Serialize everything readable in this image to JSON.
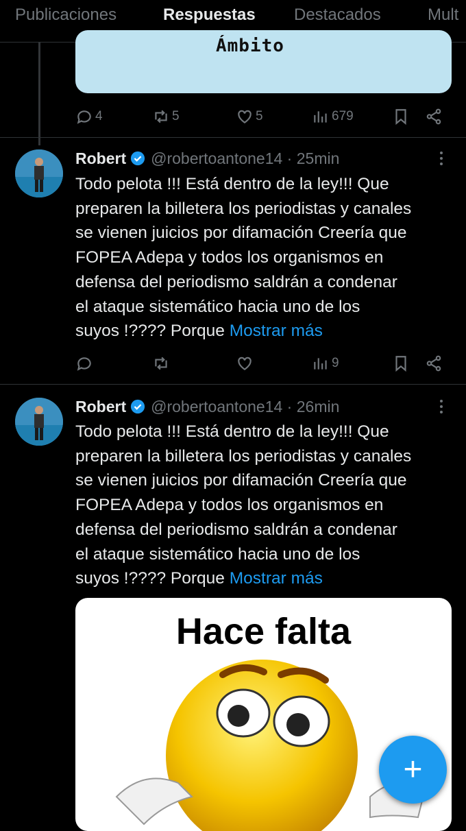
{
  "tabs": [
    "Publicaciones",
    "Respuestas",
    "Destacados",
    "Mult"
  ],
  "top_card_text": "Ámbito",
  "top_actions": {
    "replies": "4",
    "reposts": "5",
    "likes": "5",
    "views": "679"
  },
  "tweet1": {
    "name": "Robert",
    "handle": "@robertoantone14",
    "time": "25min",
    "lines": [
      "Todo pelota !!! Está dentro de la ley!!! Que",
      "preparen la billetera los periodistas y canales",
      "se vienen juicios por difamación Creería que",
      "FOPEA Adepa y todos los organismos en",
      "defensa del periodismo saldrán a condenar",
      "el ataque sistemático hacia uno de los",
      "suyos !???? Porque "
    ],
    "show_more": "Mostrar más",
    "views": "9"
  },
  "tweet2": {
    "name": "Robert",
    "handle": "@robertoantone14",
    "time": "26min",
    "lines": [
      "Todo pelota !!! Está dentro de la ley!!! Que",
      "preparen la billetera los periodistas y canales",
      "se vienen juicios por difamación Creería que",
      "FOPEA Adepa y todos los organismos en",
      "defensa del periodismo saldrán a condenar",
      "el ataque sistemático hacia uno de los",
      "suyos !???? Porque "
    ],
    "show_more": "Mostrar más",
    "media_caption": "Hace falta"
  },
  "fab_label": "+",
  "colors": {
    "accent": "#1d9bf0",
    "background": "#000000",
    "muted": "#71767b"
  }
}
